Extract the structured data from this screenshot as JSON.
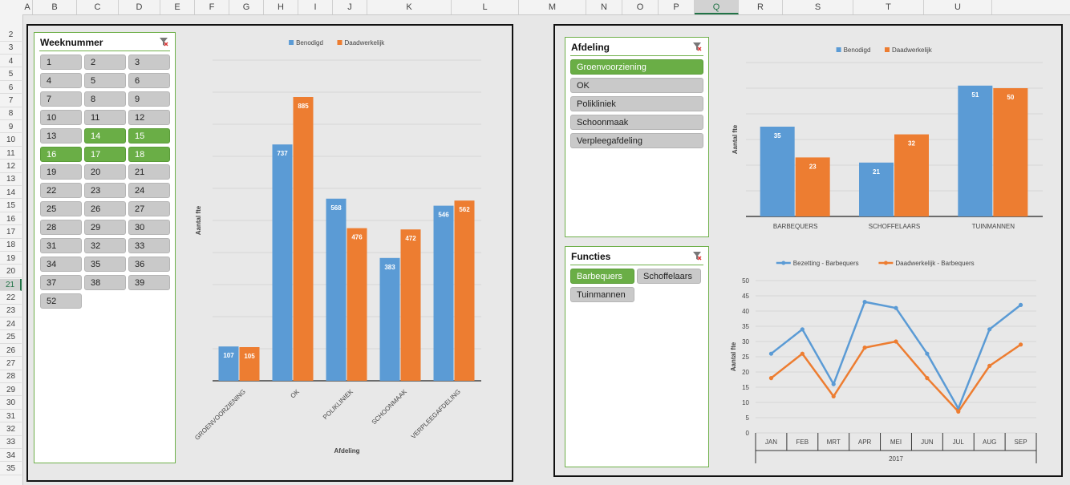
{
  "spreadsheet": {
    "name_box": "A",
    "columns": [
      "B",
      "C",
      "D",
      "E",
      "F",
      "G",
      "H",
      "I",
      "J",
      "K",
      "L",
      "M",
      "N",
      "O",
      "P",
      "Q",
      "R",
      "S",
      "T",
      "U"
    ],
    "selected_column": "Q",
    "rows": [
      "2",
      "3",
      "4",
      "5",
      "6",
      "7",
      "8",
      "9",
      "10",
      "11",
      "12",
      "13",
      "14",
      "15",
      "16",
      "17",
      "18",
      "19",
      "20",
      "21",
      "22",
      "23",
      "24",
      "25",
      "26",
      "27",
      "28",
      "29",
      "30",
      "31",
      "32",
      "33",
      "34",
      "35"
    ],
    "selected_row": "21"
  },
  "slicers": {
    "week": {
      "title": "Weeknummer",
      "items": [
        {
          "label": "1",
          "on": false
        },
        {
          "label": "2",
          "on": false
        },
        {
          "label": "3",
          "on": false
        },
        {
          "label": "4",
          "on": false
        },
        {
          "label": "5",
          "on": false
        },
        {
          "label": "6",
          "on": false
        },
        {
          "label": "7",
          "on": false
        },
        {
          "label": "8",
          "on": false
        },
        {
          "label": "9",
          "on": false
        },
        {
          "label": "10",
          "on": false
        },
        {
          "label": "11",
          "on": false
        },
        {
          "label": "12",
          "on": false
        },
        {
          "label": "13",
          "on": false
        },
        {
          "label": "14",
          "on": true
        },
        {
          "label": "15",
          "on": true
        },
        {
          "label": "16",
          "on": true
        },
        {
          "label": "17",
          "on": true
        },
        {
          "label": "18",
          "on": true
        },
        {
          "label": "19",
          "on": false
        },
        {
          "label": "20",
          "on": false
        },
        {
          "label": "21",
          "on": false
        },
        {
          "label": "22",
          "on": false
        },
        {
          "label": "23",
          "on": false
        },
        {
          "label": "24",
          "on": false
        },
        {
          "label": "25",
          "on": false
        },
        {
          "label": "26",
          "on": false
        },
        {
          "label": "27",
          "on": false
        },
        {
          "label": "28",
          "on": false
        },
        {
          "label": "29",
          "on": false
        },
        {
          "label": "30",
          "on": false
        },
        {
          "label": "31",
          "on": false
        },
        {
          "label": "32",
          "on": false
        },
        {
          "label": "33",
          "on": false
        },
        {
          "label": "34",
          "on": false
        },
        {
          "label": "35",
          "on": false
        },
        {
          "label": "36",
          "on": false
        },
        {
          "label": "37",
          "on": false
        },
        {
          "label": "38",
          "on": false
        },
        {
          "label": "39",
          "on": false
        },
        {
          "label": "52",
          "on": false
        }
      ]
    },
    "afdeling": {
      "title": "Afdeling",
      "items": [
        {
          "label": "Groenvoorziening",
          "on": true
        },
        {
          "label": "OK",
          "on": false
        },
        {
          "label": "Polikliniek",
          "on": false
        },
        {
          "label": "Schoonmaak",
          "on": false
        },
        {
          "label": "Verpleegafdeling",
          "on": false
        }
      ]
    },
    "functies": {
      "title": "Functies",
      "items": [
        {
          "label": "Barbequers",
          "on": true
        },
        {
          "label": "Schoffelaars",
          "on": false
        },
        {
          "label": "Tuinmannen",
          "on": false
        }
      ]
    }
  },
  "colors": {
    "benodigd": "#5b9bd5",
    "daadwerkelijk": "#ed7d31",
    "selected": "#6aae46",
    "unselected": "#c9c9c9"
  },
  "chart_data": [
    {
      "type": "bar",
      "legend": [
        "Benodigd",
        "Daadwerkelijk"
      ],
      "legend_position": "top",
      "categories": [
        "GROENVOORZIENING",
        "OK",
        "POLIKLINIEK",
        "SCHOONMAAK",
        "VERPLEEGAFDELING"
      ],
      "series": [
        {
          "name": "Benodigd",
          "values": [
            107,
            737,
            568,
            383,
            546
          ]
        },
        {
          "name": "Daadwerkelijk",
          "values": [
            105,
            885,
            476,
            472,
            562
          ]
        }
      ],
      "xlabel": "Afdeling",
      "ylabel": "Aantal fte",
      "ylim": [
        0,
        1000
      ],
      "grid": true
    },
    {
      "type": "bar",
      "legend": [
        "Benodigd",
        "Daadwerkelijk"
      ],
      "legend_position": "top",
      "categories": [
        "BARBEQUERS",
        "SCHOFFELAARS",
        "TUINMANNEN"
      ],
      "series": [
        {
          "name": "Benodigd",
          "values": [
            35,
            21,
            51
          ]
        },
        {
          "name": "Daadwerkelijk",
          "values": [
            23,
            32,
            50
          ]
        }
      ],
      "xlabel": "",
      "ylabel": "Aantal fte",
      "ylim": [
        0,
        60
      ],
      "grid": true
    },
    {
      "type": "line",
      "legend": [
        "Bezetting - Barbequers",
        "Daadwerkelijk - Barbequers"
      ],
      "legend_position": "top",
      "categories": [
        "JAN",
        "FEB",
        "MRT",
        "APR",
        "MEI",
        "JUN",
        "JUL",
        "AUG",
        "SEP"
      ],
      "group_label": "2017",
      "series": [
        {
          "name": "Bezetting - Barbequers",
          "values": [
            26,
            34,
            16,
            43,
            41,
            26,
            8,
            34,
            42
          ]
        },
        {
          "name": "Daadwerkelijk - Barbequers",
          "values": [
            18,
            26,
            12,
            28,
            30,
            18,
            7,
            22,
            29
          ]
        }
      ],
      "ylabel": "Aantal fte",
      "yticks": [
        "0",
        "5",
        "10",
        "15",
        "20",
        "25",
        "30",
        "35",
        "40",
        "45",
        "50"
      ],
      "ylim": [
        0,
        50
      ],
      "grid": true
    }
  ]
}
